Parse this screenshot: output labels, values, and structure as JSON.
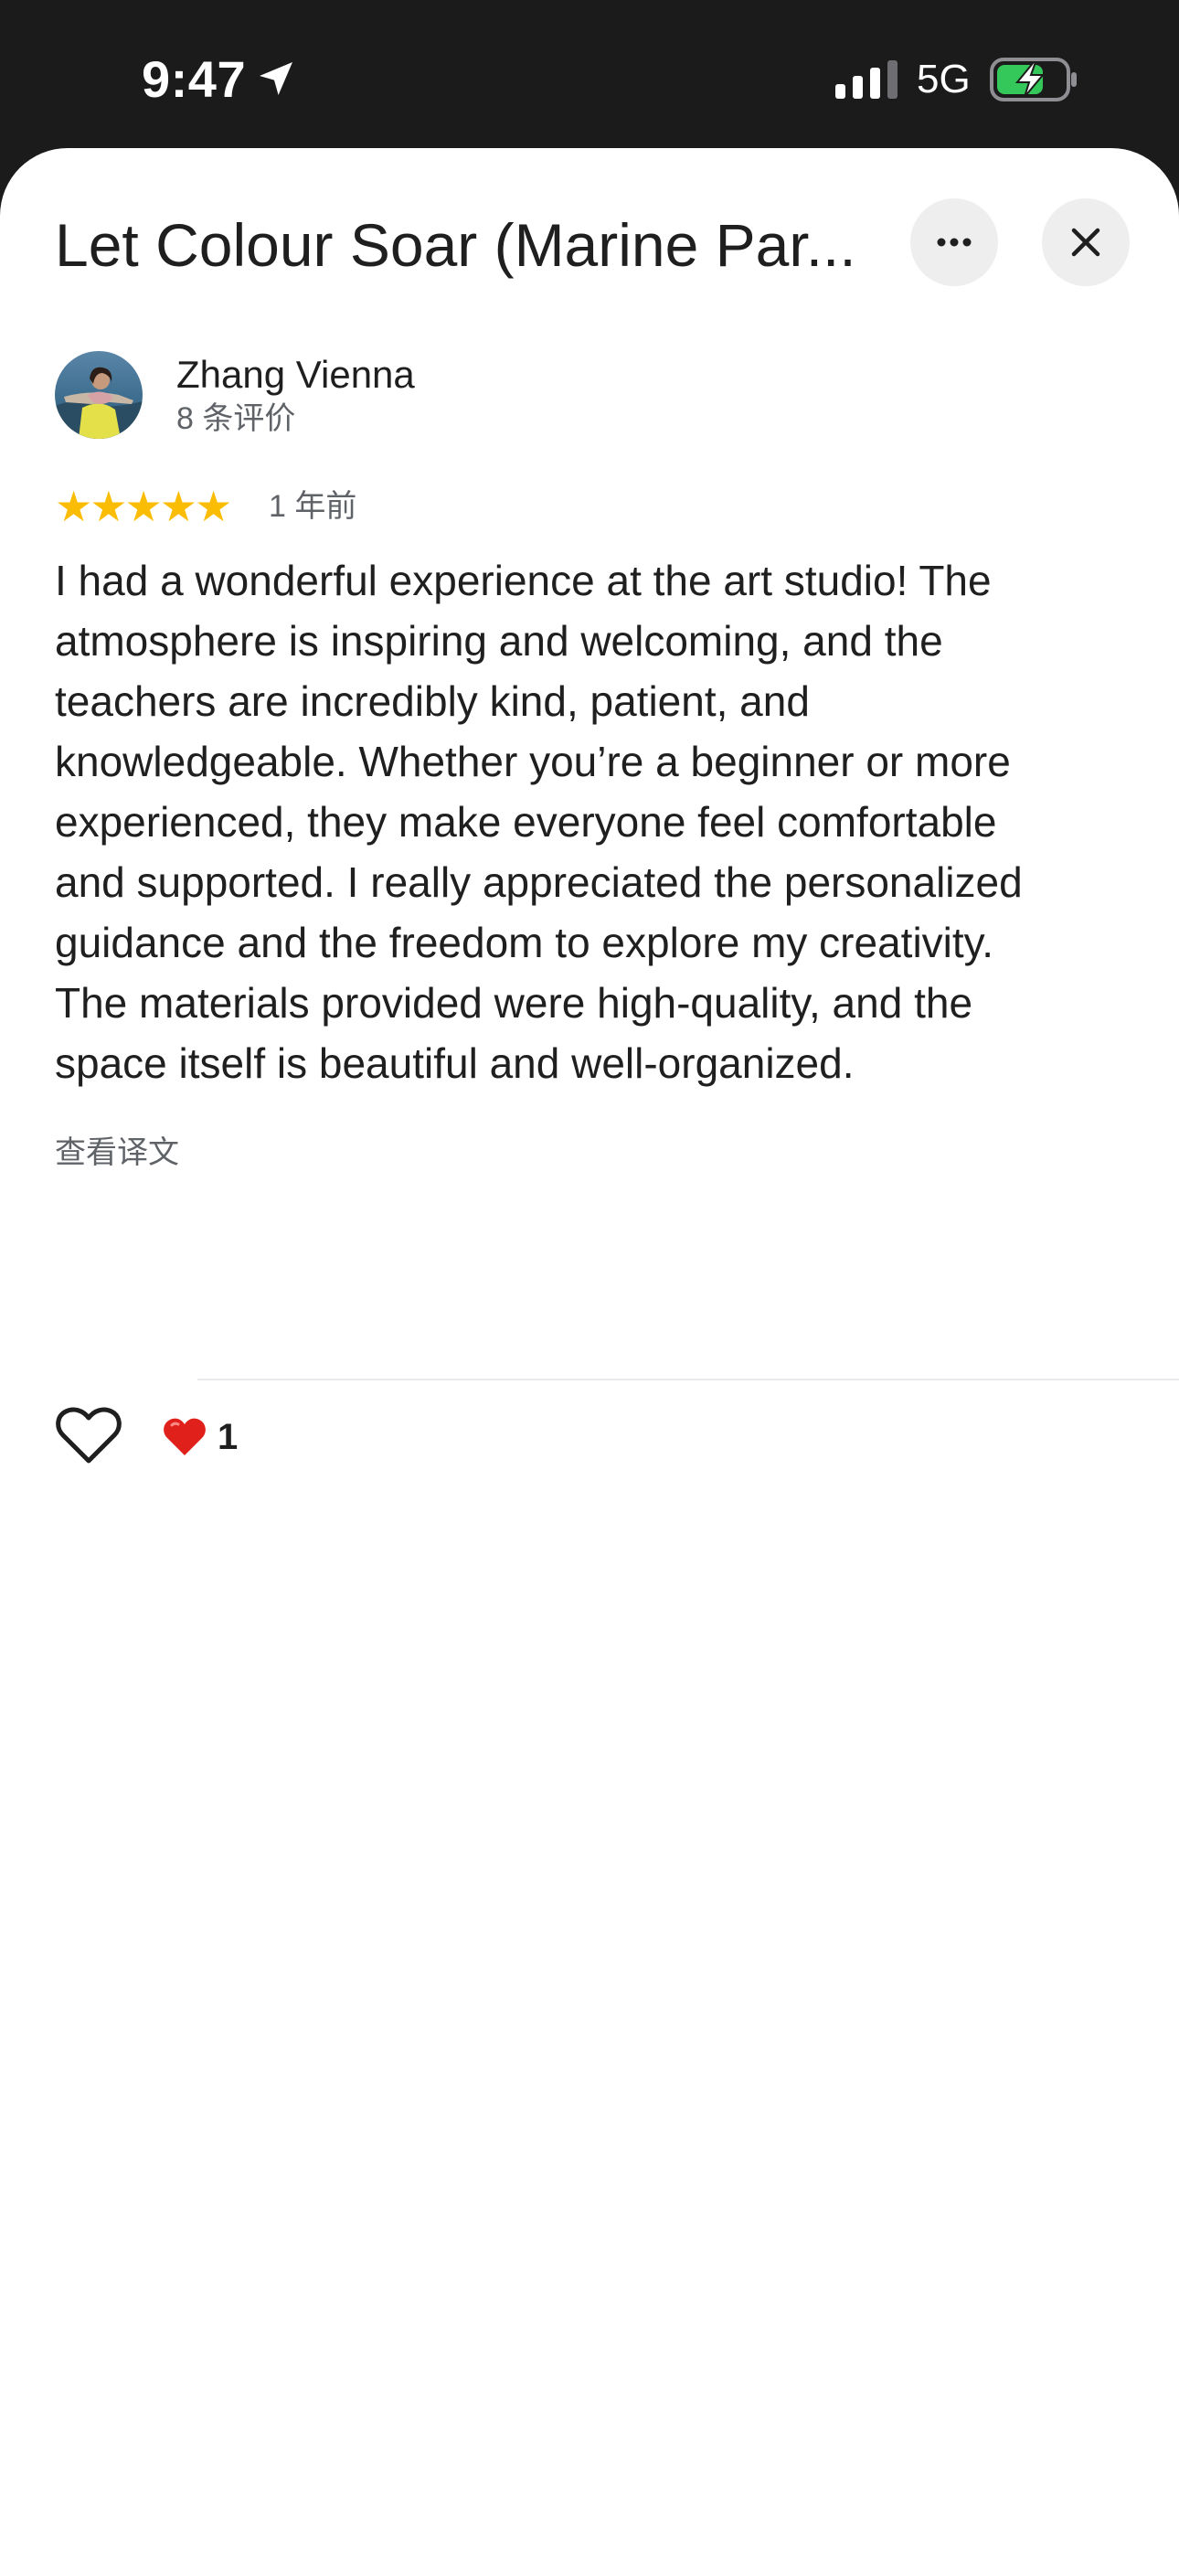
{
  "status_bar": {
    "time": "9:47",
    "network": "5G",
    "icons": [
      "location-arrow-icon",
      "cellular-signal-icon",
      "battery-charging-icon"
    ]
  },
  "sheet": {
    "title": "Let Colour Soar (Marine Par...",
    "more_icon": "more-horizontal-icon",
    "close_icon": "close-icon"
  },
  "review": {
    "reviewer_name": "Zhang Vienna",
    "reviewer_review_count": "8 条评价",
    "rating_stars": 5,
    "age": "1 年前",
    "text_lines": [
      "I had a wonderful experience at the art studio! The",
      "atmosphere is inspiring and welcoming, and the",
      "teachers are incredibly kind, patient, and",
      "knowledgeable. Whether you’re a beginner or more",
      "experienced, they make everyone feel comfortable",
      "and supported. I really appreciated the personalized",
      "guidance and the freedom to explore my creativity.",
      "The materials provided were high-quality, and the",
      "space itself is beautiful and well-organized."
    ],
    "translate_label": "查看译文",
    "like_icon": "heart-outline-icon",
    "reaction_emoji": "red-heart-emoji-icon",
    "reaction_count": "1"
  },
  "colors": {
    "status_bar_bg": "#1b1b1c",
    "sheet_bg": "#ffffff",
    "star": "#fbbc04",
    "secondary_text": "#5f6368",
    "battery_fill": "#34c759",
    "heart_emoji": "#e0201b"
  }
}
